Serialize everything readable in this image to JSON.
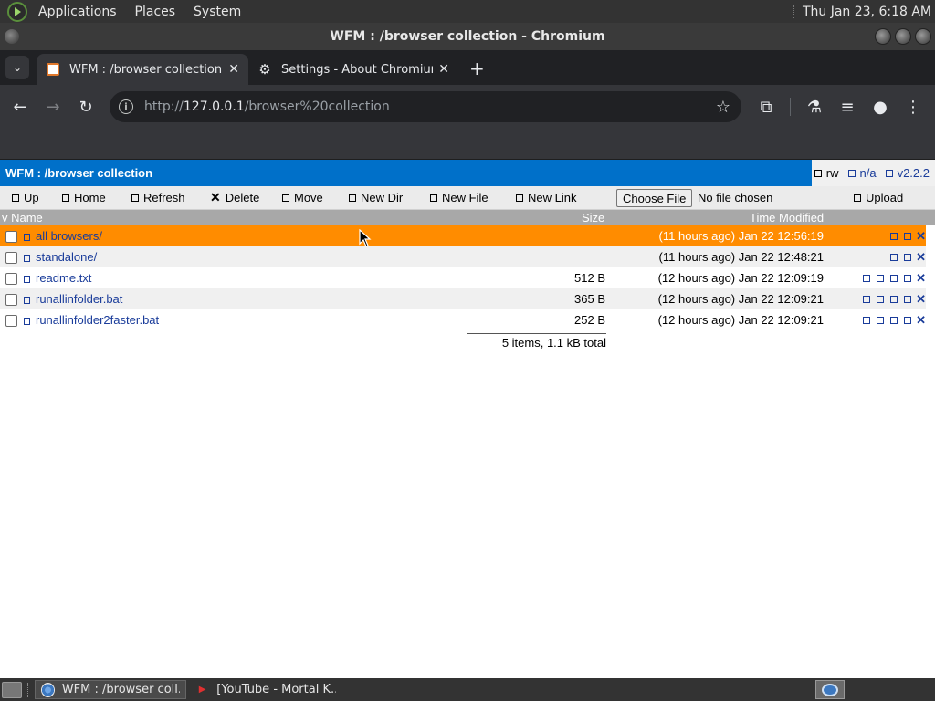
{
  "top_panel": {
    "menus": [
      "Applications",
      "Places",
      "System"
    ],
    "clock": "Thu Jan 23,  6:18 AM"
  },
  "window": {
    "title": "WFM : /browser collection - Chromium"
  },
  "tabs": [
    {
      "title": "WFM : /browser collection",
      "close": "✕"
    },
    {
      "title": "Settings - About Chromium",
      "close": "✕"
    }
  ],
  "new_tab_glyph": "+",
  "toolbar": {
    "back": "←",
    "forward": "→",
    "reload": "↻",
    "url_scheme": "http://",
    "url_host": "127.0.0.1",
    "url_path": "/browser%20collection",
    "star": "☆",
    "extensions": "⧉",
    "labs": "⚗",
    "media": "≡",
    "profile": "●",
    "menu": "⋮"
  },
  "wfm": {
    "title": "WFM : /browser collection",
    "meta": {
      "rw": "rw",
      "na": "n/a",
      "version": "v2.2.2"
    },
    "actions": {
      "up": "Up",
      "home": "Home",
      "refresh": "Refresh",
      "delete": "Delete",
      "move": "Move",
      "new_dir": "New Dir",
      "new_file": "New File",
      "new_link": "New Link",
      "choose_file": "Choose File",
      "no_file": "No file chosen",
      "upload": "Upload"
    },
    "columns": {
      "name": "v Name",
      "size": "Size",
      "time": "Time Modified"
    },
    "files": [
      {
        "name": "all browsers/",
        "size": "",
        "time": "(11 hours ago) Jan 22 12:56:19",
        "selected": true
      },
      {
        "name": "standalone/",
        "size": "",
        "time": "(11 hours ago) Jan 22 12:48:21",
        "selected": false
      },
      {
        "name": "readme.txt",
        "size": "512 B",
        "time": "(12 hours ago) Jan 22 12:09:19",
        "selected": false
      },
      {
        "name": "runallinfolder.bat",
        "size": "365 B",
        "time": "(12 hours ago) Jan 22 12:09:21",
        "selected": false
      },
      {
        "name": "runallinfolder2faster.bat",
        "size": "252 B",
        "time": "(12 hours ago) Jan 22 12:09:21",
        "selected": false
      }
    ],
    "summary": "5 items, 1.1 kB total"
  },
  "taskbar": {
    "tasks": [
      {
        "label": "WFM : /browser coll..."
      },
      {
        "label": "[YouTube - Mortal K..."
      }
    ]
  },
  "colors": {
    "wfm_header": "#0070c9",
    "selected_row": "#ff8c00",
    "link": "#1a3c9a"
  }
}
